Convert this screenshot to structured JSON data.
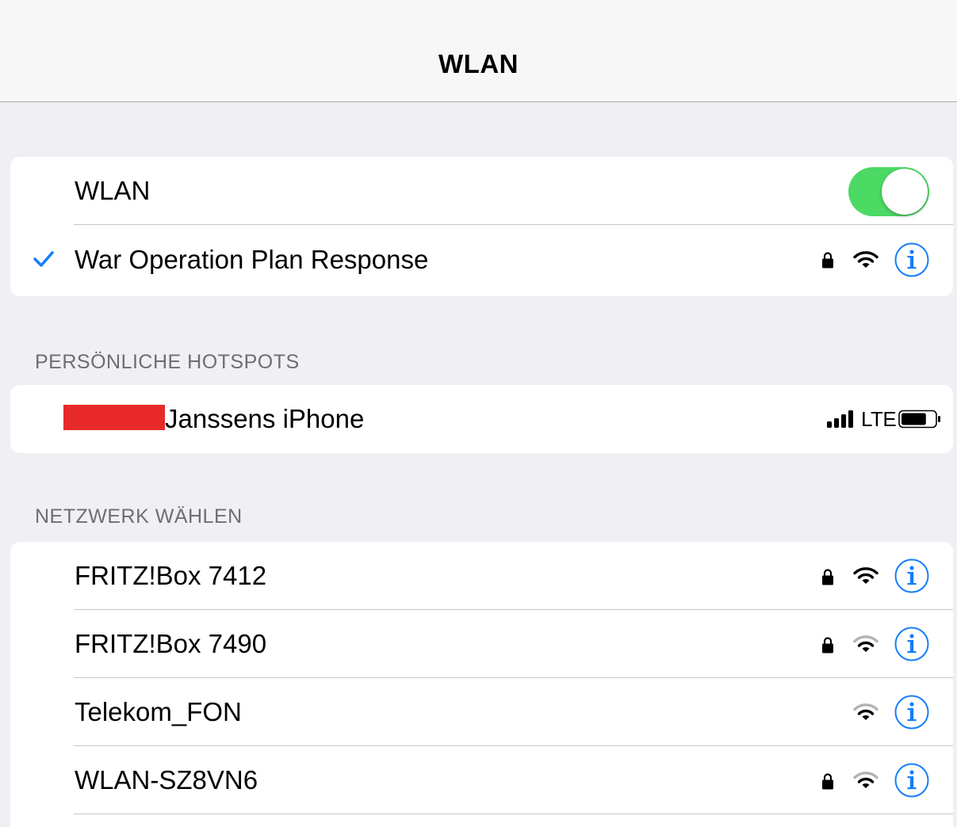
{
  "nav": {
    "title": "WLAN"
  },
  "wlan_toggle": {
    "label": "WLAN",
    "state": "on",
    "on_color": "#4cd964"
  },
  "connected_network": {
    "name": "War Operation Plan Response",
    "secured": true,
    "signal": "full",
    "check_icon": "checkmark-icon"
  },
  "hotspots": {
    "header": "PERSÖNLICHE HOTSPOTS",
    "items": [
      {
        "name": "Janssens iPhone",
        "network_type": "LTE",
        "signal_bars": 4,
        "battery": 0.75,
        "redacted_prefix": true
      }
    ]
  },
  "networks": {
    "header": "NETZWERK WÄHLEN",
    "items": [
      {
        "name": "FRITZ!Box 7412",
        "secured": true,
        "signal": "full"
      },
      {
        "name": "FRITZ!Box 7490",
        "secured": true,
        "signal": "medium"
      },
      {
        "name": "Telekom_FON",
        "secured": false,
        "signal": "medium"
      },
      {
        "name": "WLAN-SZ8VN6",
        "secured": true,
        "signal": "medium"
      }
    ]
  },
  "colors": {
    "accent": "#147efb",
    "background": "#efeff4",
    "redaction": "#e8292a"
  }
}
